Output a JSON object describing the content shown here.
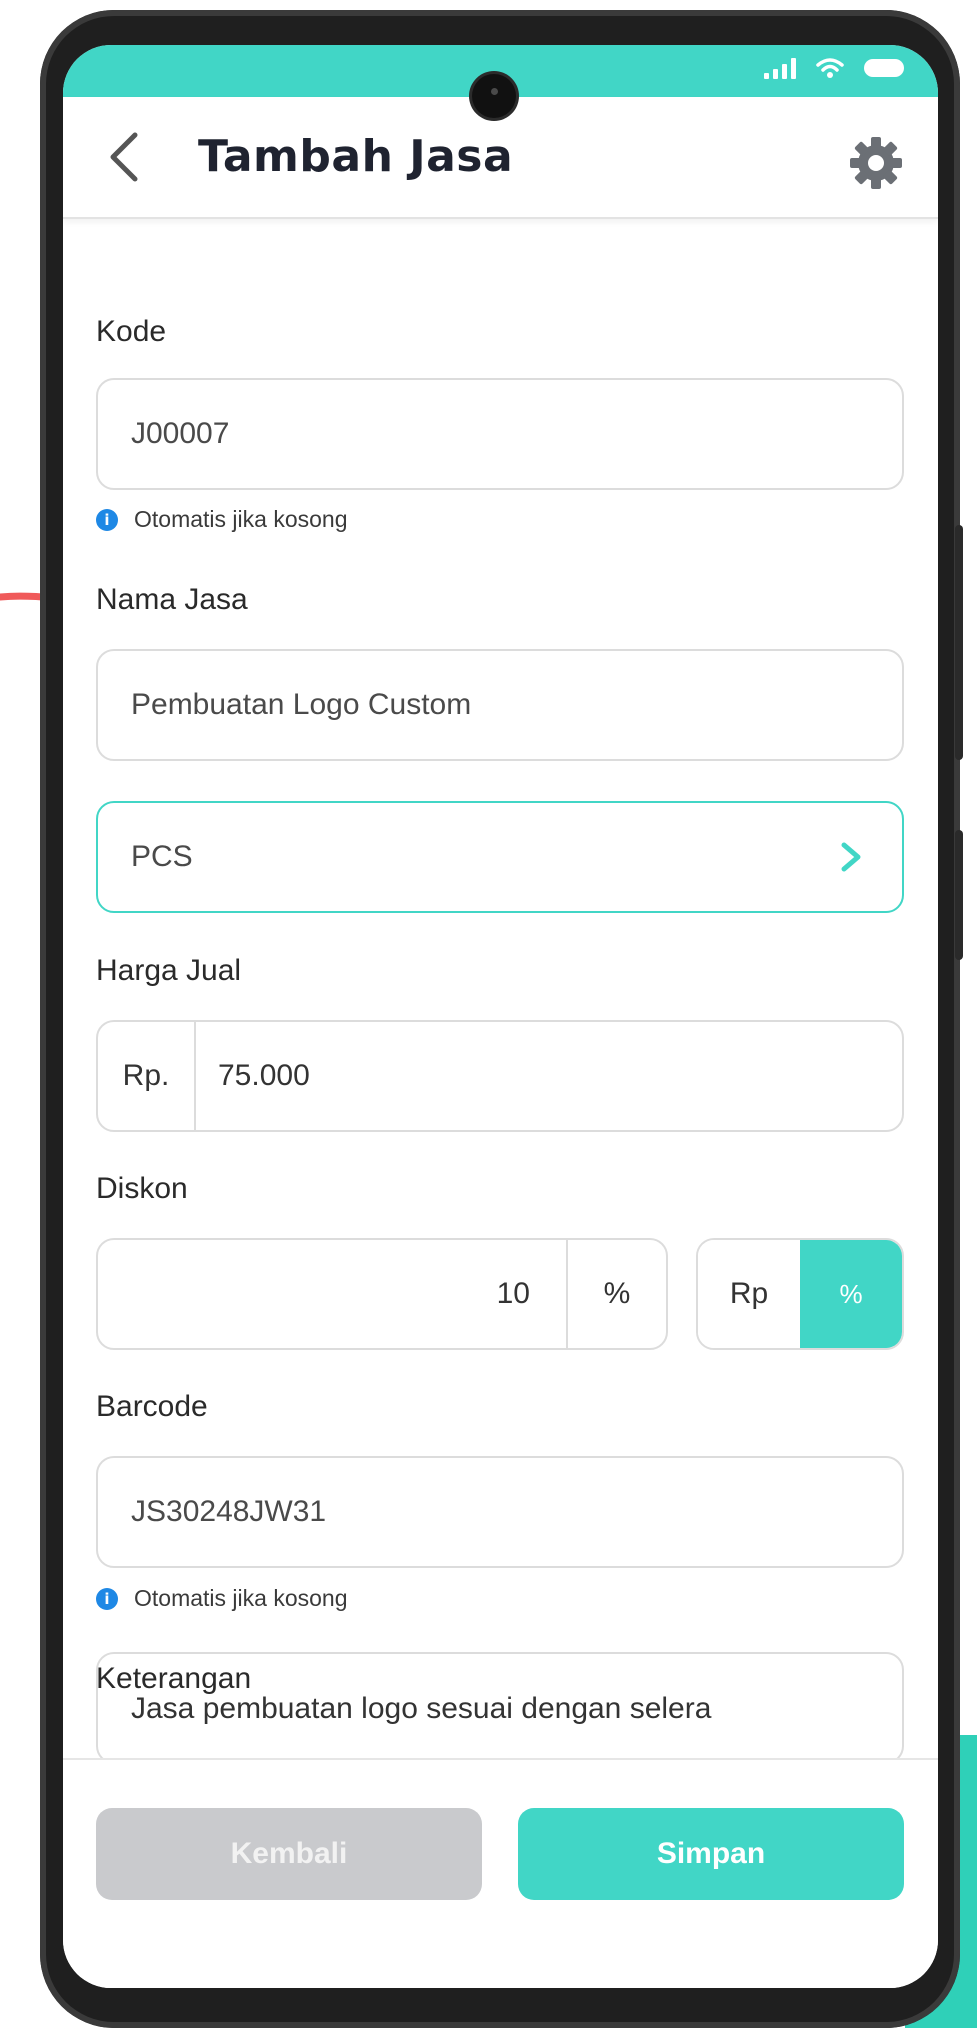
{
  "app": {
    "title": "Tambah Jasa"
  },
  "form": {
    "kode": {
      "label": "Kode",
      "value": "J00007",
      "hint": "Otomatis jika kosong"
    },
    "nama_jasa": {
      "label": "Nama Jasa",
      "value": "Pembuatan Logo Custom"
    },
    "satuan": {
      "value": "PCS"
    },
    "harga_jual": {
      "label": "Harga Jual",
      "prefix": "Rp.",
      "value": "75.000"
    },
    "diskon": {
      "label": "Diskon",
      "value": "10",
      "suffix": "%",
      "toggle_rp": "Rp",
      "toggle_pct": "%",
      "selected": "%"
    },
    "barcode": {
      "label": "Barcode",
      "value": "JS30248JW31",
      "hint": "Otomatis jika kosong"
    },
    "keterangan": {
      "label": "Keterangan",
      "value": "Jasa pembuatan logo sesuai dengan selera"
    }
  },
  "actions": {
    "back_label": "Kembali",
    "save_label": "Simpan"
  },
  "colors": {
    "accent": "#41d6c6",
    "disabled": "#c9cacd",
    "info": "#1e88e5",
    "annotation_arrow": "#f05a5a"
  },
  "icons": [
    "back-arrow-icon",
    "gear-icon",
    "info-icon",
    "chevron-right-icon",
    "signal-icon",
    "wifi-icon",
    "battery-icon"
  ]
}
